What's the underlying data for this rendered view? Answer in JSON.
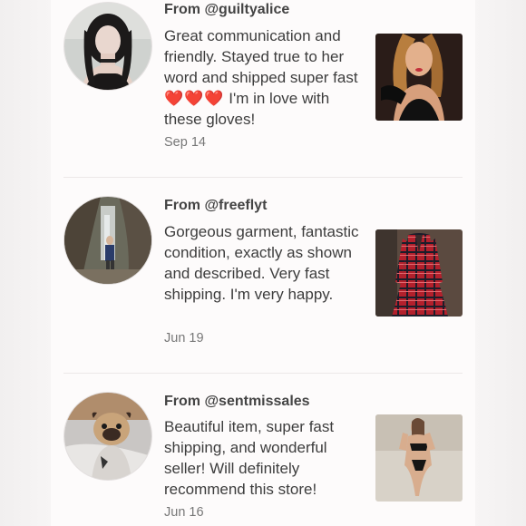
{
  "reviews": [
    {
      "from": "From @guiltyalice",
      "text_before": "Great communication and friendly. Stayed true to her word and shipped super fast",
      "hearts": "❤️❤️❤️",
      "text_after": "I'm in love with these gloves!",
      "date": "Sep 14"
    },
    {
      "from": "From @freeflyt",
      "text": "Gorgeous garment, fantastic condition, exactly as shown and described. Very fast shipping. I'm very happy.",
      "date": "Jun 19"
    },
    {
      "from": "From @sentmissales",
      "text": "Beautiful item, super fast shipping, and wonderful seller! Will definitely recommend this store!",
      "date": "Jun 16"
    }
  ],
  "colors": {
    "background": "#fdfbfb",
    "text": "#3d3d3d",
    "date": "#777777",
    "heart": "#e5231f",
    "divider": "#ece8e8"
  }
}
